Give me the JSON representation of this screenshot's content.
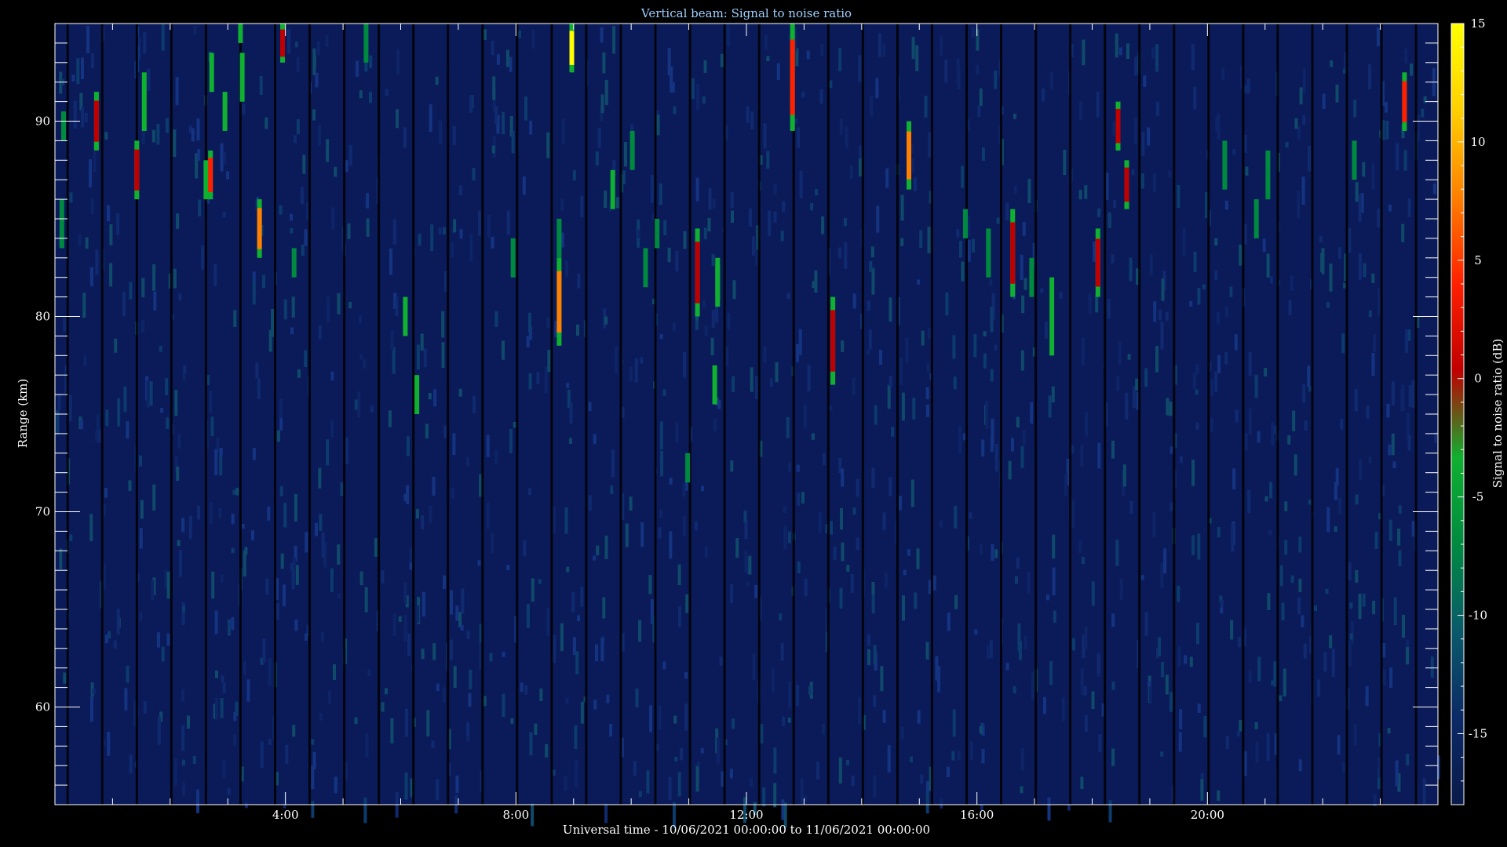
{
  "chart_data": {
    "type": "heatmap",
    "title": "Vertical beam: Signal to noise ratio",
    "xlabel": "Universal time - 10/06/2021 00:00:00 to 11/06/2021 00:00:00",
    "ylabel": "Range (km)",
    "xlim_hours": [
      0,
      24
    ],
    "ylim_km": [
      55,
      95
    ],
    "x_ticks": [
      {
        "value": 4,
        "label": "4:00"
      },
      {
        "value": 8,
        "label": "8:00"
      },
      {
        "value": 12,
        "label": "12:00"
      },
      {
        "value": 16,
        "label": "16:00"
      },
      {
        "value": 20,
        "label": "20:00"
      }
    ],
    "y_ticks": [
      {
        "value": 60,
        "label": "60"
      },
      {
        "value": 70,
        "label": "70"
      },
      {
        "value": 80,
        "label": "80"
      },
      {
        "value": 90,
        "label": "90"
      }
    ],
    "colorbar": {
      "label": "Signal to noise ratio (dB)",
      "range": [
        -18,
        15
      ],
      "ticks": [
        {
          "value": 15,
          "label": "15"
        },
        {
          "value": 10,
          "label": "10"
        },
        {
          "value": 5,
          "label": "5"
        },
        {
          "value": 0,
          "label": "0"
        },
        {
          "value": -5,
          "label": "-5"
        },
        {
          "value": -10,
          "label": "-10"
        },
        {
          "value": -15,
          "label": "-15"
        }
      ],
      "colors": [
        "#0a1a4a",
        "#0b2a66",
        "#0a5a6a",
        "#008a40",
        "#10b030",
        "#c00000",
        "#ff2000",
        "#ff8000",
        "#ffd000",
        "#ffff00"
      ]
    },
    "background_color": "#0b1b5a",
    "echoes": [
      {
        "t": 0.12,
        "r0": 83.5,
        "r1": 86,
        "snr": -8
      },
      {
        "t": 0.15,
        "r0": 89,
        "r1": 90.5,
        "snr": -7
      },
      {
        "t": 0.72,
        "r0": 88.5,
        "r1": 91.5,
        "snr": 2
      },
      {
        "t": 1.42,
        "r0": 86,
        "r1": 89,
        "snr": 1
      },
      {
        "t": 1.55,
        "r0": 89.5,
        "r1": 92.5,
        "snr": -5
      },
      {
        "t": 2.62,
        "r0": 86,
        "r1": 88,
        "snr": -5
      },
      {
        "t": 2.72,
        "r0": 91.5,
        "r1": 93.5,
        "snr": -5
      },
      {
        "t": 2.7,
        "r0": 86,
        "r1": 88.5,
        "snr": 3
      },
      {
        "t": 2.95,
        "r0": 89.5,
        "r1": 91.5,
        "snr": -5
      },
      {
        "t": 3.25,
        "r0": 91,
        "r1": 93.5,
        "snr": -5
      },
      {
        "t": 3.22,
        "r0": 94,
        "r1": 95,
        "snr": -5
      },
      {
        "t": 3.55,
        "r0": 83,
        "r1": 86,
        "snr": 7
      },
      {
        "t": 3.95,
        "r0": 93,
        "r1": 95,
        "snr": 1
      },
      {
        "t": 4.15,
        "r0": 82,
        "r1": 83.5,
        "snr": -6
      },
      {
        "t": 5.4,
        "r0": 93,
        "r1": 95,
        "snr": -6
      },
      {
        "t": 6.08,
        "r0": 79,
        "r1": 81,
        "snr": -5
      },
      {
        "t": 6.28,
        "r0": 75,
        "r1": 77,
        "snr": -5
      },
      {
        "t": 7.95,
        "r0": 82,
        "r1": 84,
        "snr": -7
      },
      {
        "t": 8.75,
        "r0": 78.5,
        "r1": 83,
        "snr": 6
      },
      {
        "t": 8.75,
        "r0": 83,
        "r1": 85,
        "snr": -6
      },
      {
        "t": 8.97,
        "r0": 92.5,
        "r1": 95,
        "snr": 14
      },
      {
        "t": 9.68,
        "r0": 85.5,
        "r1": 87.5,
        "snr": -5
      },
      {
        "t": 10.02,
        "r0": 87.5,
        "r1": 89.5,
        "snr": -6
      },
      {
        "t": 10.25,
        "r0": 81.5,
        "r1": 83.5,
        "snr": -7
      },
      {
        "t": 10.45,
        "r0": 83.5,
        "r1": 85,
        "snr": -7
      },
      {
        "t": 10.98,
        "r0": 71.5,
        "r1": 73,
        "snr": -6
      },
      {
        "t": 11.15,
        "r0": 80,
        "r1": 84.5,
        "snr": 2
      },
      {
        "t": 11.45,
        "r0": 75.5,
        "r1": 77.5,
        "snr": -5
      },
      {
        "t": 11.5,
        "r0": 80.5,
        "r1": 83,
        "snr": -4
      },
      {
        "t": 12.8,
        "r0": 89.5,
        "r1": 95,
        "snr": 4
      },
      {
        "t": 13.5,
        "r0": 76.5,
        "r1": 81,
        "snr": 1
      },
      {
        "t": 14.82,
        "r0": 86.5,
        "r1": 90,
        "snr": 7
      },
      {
        "t": 15.8,
        "r0": 84,
        "r1": 85.5,
        "snr": -7
      },
      {
        "t": 16.2,
        "r0": 82,
        "r1": 84.5,
        "snr": -6
      },
      {
        "t": 16.62,
        "r0": 81,
        "r1": 85.5,
        "snr": 2
      },
      {
        "t": 16.95,
        "r0": 81,
        "r1": 83,
        "snr": -7
      },
      {
        "t": 17.3,
        "r0": 78,
        "r1": 82,
        "snr": -5
      },
      {
        "t": 18.1,
        "r0": 81,
        "r1": 84.5,
        "snr": 2
      },
      {
        "t": 18.45,
        "r0": 88.5,
        "r1": 91,
        "snr": 2
      },
      {
        "t": 18.6,
        "r0": 85.5,
        "r1": 88,
        "snr": 2
      },
      {
        "t": 20.3,
        "r0": 86.5,
        "r1": 89,
        "snr": -6
      },
      {
        "t": 20.85,
        "r0": 84,
        "r1": 86,
        "snr": -7
      },
      {
        "t": 21.05,
        "r0": 86,
        "r1": 88.5,
        "snr": -6
      },
      {
        "t": 22.55,
        "r0": 87,
        "r1": 89,
        "snr": -6
      },
      {
        "t": 23.42,
        "r0": 89.5,
        "r1": 92.5,
        "snr": 3
      }
    ]
  }
}
